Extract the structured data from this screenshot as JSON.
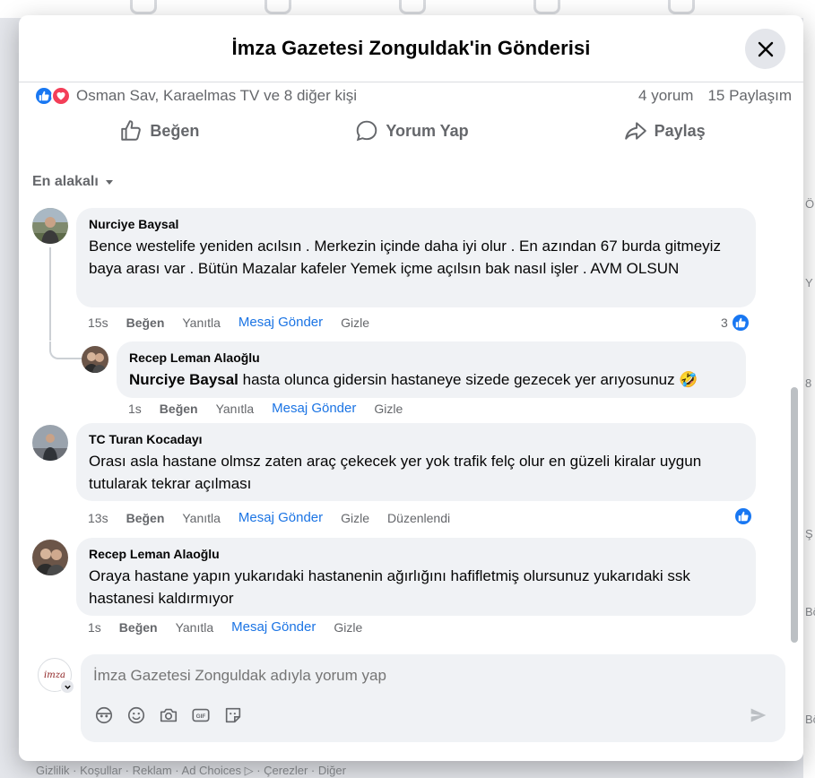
{
  "background": {
    "footer": "Gizlilik · Koşullar · Reklam · Ad Choices ▷ · Çerezler · Diğer",
    "right_fragments": [
      "ÖNE",
      "Y",
      "8",
      "Ş",
      "Bö",
      "Bö"
    ]
  },
  "modal": {
    "title": "İmza Gazetesi Zonguldak'in Gönderisi"
  },
  "reactions": {
    "names": "Osman Sav, Karaelmas TV ve 8 diğer kişi",
    "comment_count": "4 yorum",
    "share_count": "15 Paylaşım"
  },
  "actions": {
    "like": "Beğen",
    "comment": "Yorum Yap",
    "share": "Paylaş"
  },
  "sort_label": "En alakalı",
  "comments": [
    {
      "author": "Nurciye Baysal",
      "text": "Bence westelife yeniden acılsın . Merkezin içinde daha iyi olur . En azından 67 burda gitmeyiz baya arası var . Bütün Mazalar kafeler Yemek içme açılsın bak nasıl işler . AVM OLSUN",
      "time": "15s",
      "like": "Beğen",
      "reply": "Yanıtla",
      "message": "Mesaj Gönder",
      "hide": "Gizle",
      "reaction_count": "3"
    },
    {
      "author": "Recep Leman Alaoğlu",
      "mention": "Nurciye Baysal",
      "text": "hasta olunca gidersin hastaneye sizede gezecek yer arıyosunuz 🤣",
      "time": "1s",
      "like": "Beğen",
      "reply": "Yanıtla",
      "message": "Mesaj Gönder",
      "hide": "Gizle"
    },
    {
      "author": "TC Turan Kocadayı",
      "text": "Orası asla hastane olmsz zaten araç çekecek yer yok trafik felç olur en güzeli kiralar uygun tutularak tekrar açılması",
      "time": "13s",
      "like": "Beğen",
      "reply": "Yanıtla",
      "message": "Mesaj Gönder",
      "hide": "Gizle",
      "edited": "Düzenlendi"
    },
    {
      "author": "Recep Leman Alaoğlu",
      "text": "Oraya hastane yapın yukarıdaki hastanenin ağırlığını hafifletmiş olursunuz yukarıdaki ssk hastanesi kaldırmıyor",
      "time": "1s",
      "like": "Beğen",
      "reply": "Yanıtla",
      "message": "Mesaj Gönder",
      "hide": "Gizle"
    }
  ],
  "composer": {
    "avatar_text": "imza",
    "placeholder": "İmza Gazetesi Zonguldak adıyla yorum yap"
  },
  "colors": {
    "accent": "#1877f2",
    "link": "#1b74e4",
    "love": "#f33e58",
    "bubble": "#f0f2f5",
    "muted": "#65676b"
  }
}
